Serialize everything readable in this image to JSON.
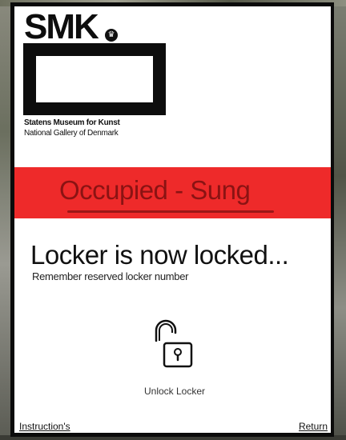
{
  "logo": {
    "wordmark": "SMK",
    "crown_icon": "crown-icon"
  },
  "museum": {
    "name": "Statens Museum for Kunst",
    "subtitle": "National Gallery of Denmark"
  },
  "status": {
    "text": "Occupied - Sung",
    "band_color": "#ee2a2a",
    "text_color": "#8b1313"
  },
  "message": {
    "title": "Locker is now locked...",
    "subtitle": "Remember reserved locker number"
  },
  "unlock": {
    "label": "Unlock Locker",
    "icon": "unlocked-padlock-icon"
  },
  "footer": {
    "instructions_label": "Instruction's",
    "return_label": "Return"
  }
}
